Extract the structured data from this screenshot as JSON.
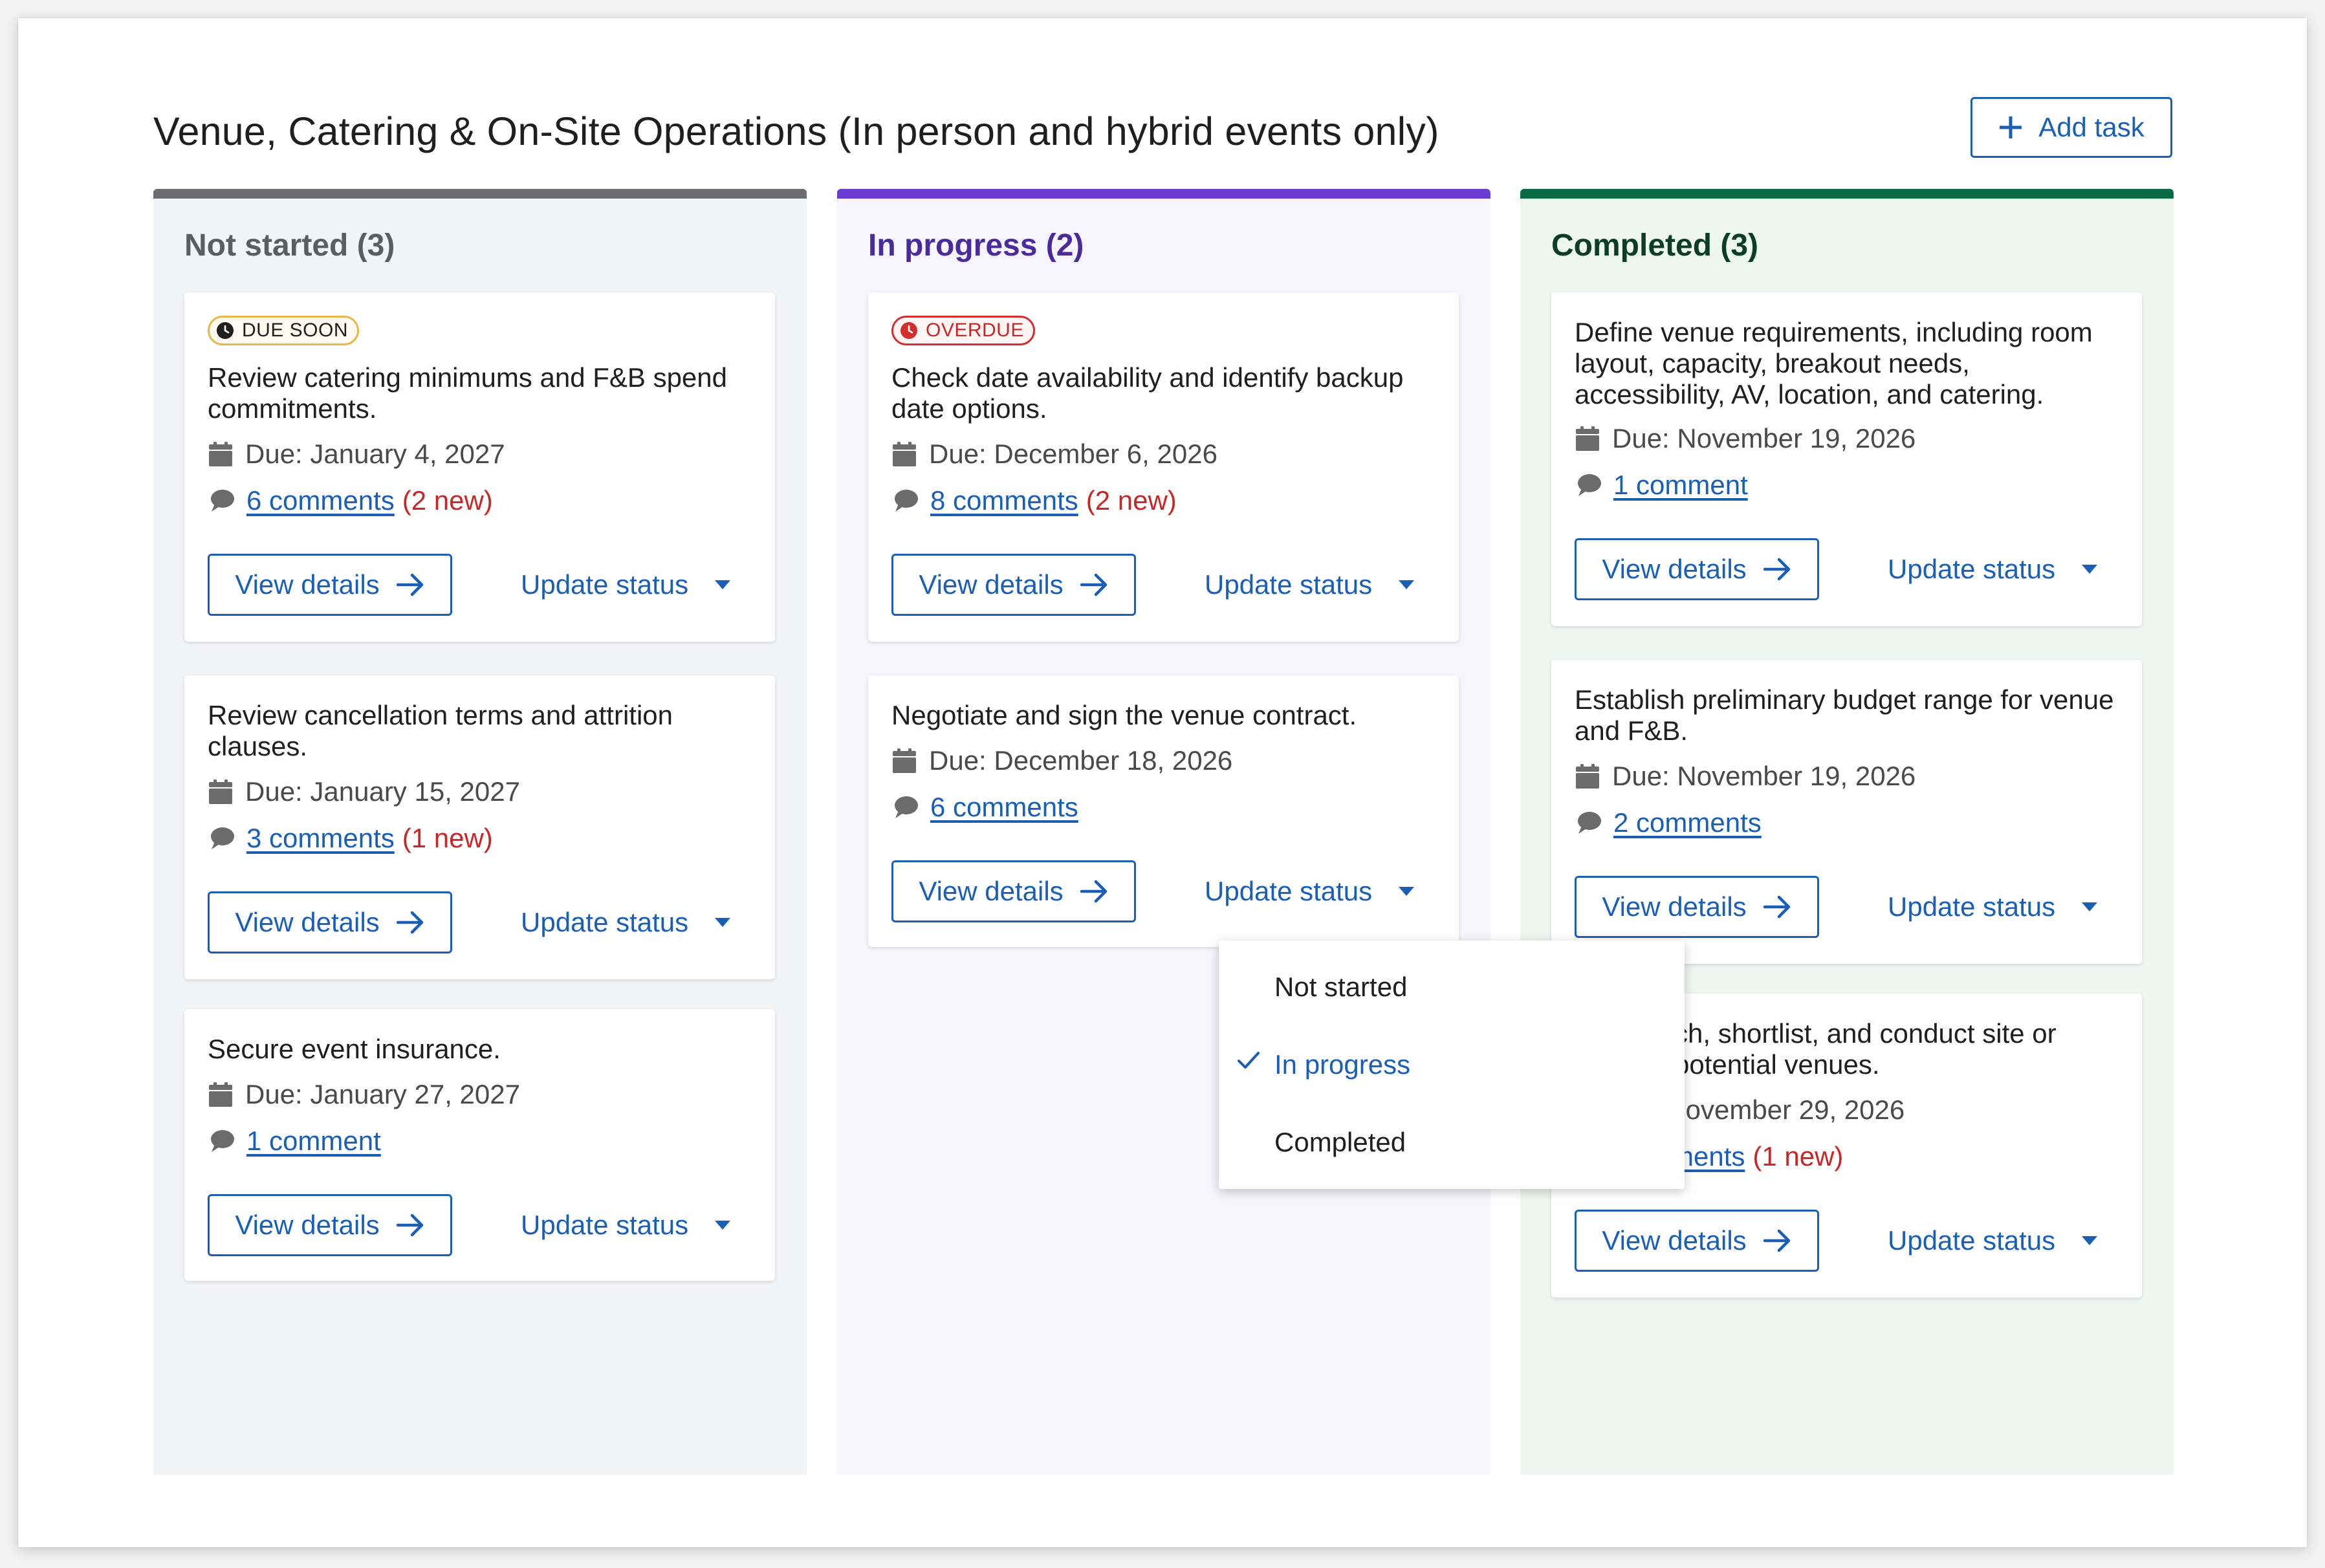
{
  "header": {
    "title": "Venue, Catering & On-Site Operations (In person and hybrid events only)",
    "add_task_label": "Add task"
  },
  "colors": {
    "accent": "#1a5fb4",
    "not_started": "#6b6d72",
    "in_progress": "#6c3bd1",
    "completed": "#0b6b44",
    "new_comments": "#c62828"
  },
  "columns": [
    {
      "title": "Not started (3)",
      "cards": [
        {
          "badge": "DUE SOON",
          "title": "Review catering minimums and F&B spend commitments.",
          "due": "Due: January 4, 2027",
          "comments": "6 comments",
          "new": "(2 new)",
          "view_label": "View details",
          "status_label": "Update status"
        },
        {
          "title": "Review cancellation terms and attrition clauses.",
          "due": "Due: January 15, 2027",
          "comments": "3 comments",
          "new": "(1 new)",
          "view_label": "View details",
          "status_label": "Update status"
        },
        {
          "title": "Secure event insurance.",
          "due": "Due: January 27, 2027",
          "comments": "1 comment",
          "view_label": "View details",
          "status_label": "Update status"
        }
      ]
    },
    {
      "title": "In progress (2)",
      "cards": [
        {
          "badge": "OVERDUE",
          "title": "Check date availability and identify backup date options.",
          "due": "Due: December 6, 2026",
          "comments": "8 comments",
          "new": "(2 new)",
          "view_label": "View details",
          "status_label": "Update status"
        },
        {
          "title": "Negotiate and sign the venue contract.",
          "due": "Due: December 18, 2026",
          "comments": "6 comments",
          "view_label": "View details",
          "status_label": "Update status"
        }
      ]
    },
    {
      "title": "Completed (3)",
      "cards": [
        {
          "title": "Define venue requirements, including room layout, capacity, breakout needs, accessibility, AV, location, and catering.",
          "due": "Due: November 19, 2026",
          "comments": "1 comment",
          "view_label": "View details",
          "status_label": "Update status"
        },
        {
          "title": "Establish preliminary budget range for venue and F&B.",
          "due": "Due: November 19, 2026",
          "comments": "2 comments",
          "view_label": "View details",
          "status_label": "Update status"
        },
        {
          "title": "ch, shortlist, and conduct site or potential venues.",
          "due": ": November 29, 2026",
          "comments": "mments",
          "new": "(1 new)",
          "view_label": "View details",
          "status_label": "Update status"
        }
      ]
    }
  ],
  "status_menu": {
    "options": [
      "Not started",
      "In progress",
      "Completed"
    ],
    "selected": "In progress"
  }
}
